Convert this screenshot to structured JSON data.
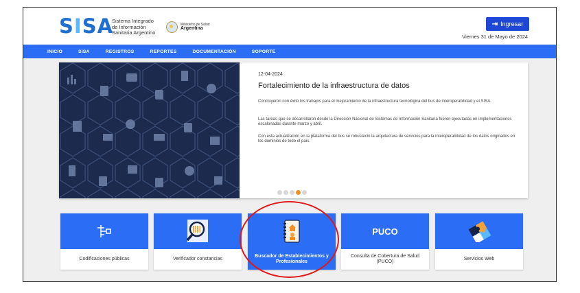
{
  "header": {
    "logo_word_prefix": "S",
    "logo_word_i": "I",
    "logo_word_suffix": "SA",
    "logo_sub": [
      "Sistema Integrado",
      "de Información",
      "Sanitaria Argentino"
    ],
    "ministry_line": "Ministerio de Salud",
    "ministry_country": "Argentina",
    "login_label": "Ingresar",
    "login_icon": "sign-in-icon",
    "date": "Viernes 31 de Mayo de 2024"
  },
  "nav": {
    "items": [
      "INICIO",
      "SISA",
      "REGISTROS",
      "REPORTES",
      "DOCUMENTACIÓN",
      "SOPORTE"
    ]
  },
  "news": {
    "date": "12-04-2024",
    "title": "Fortalecimiento de la infraestructura de datos",
    "paragraphs": [
      "Concluyeron con éxito los trabajos para el mejoramiento de la infraestructura tecnológica del bus de interoperabilidad y el SISA.",
      "Las tareas que se desarrollaron desde la Dirección Nacional de Sistemas de Información Sanitaria fueron ejecutadas en implementaciones escalonadas durante marzo y abril.",
      "Con esta actualización en la plataforma del bus se robusteció la arquitectura de servicios para la interoperabilidad de los datos originados en los dominios de todo el país."
    ],
    "carousel_active": 3,
    "carousel_count": 4
  },
  "tiles": [
    {
      "label": "Codificaciones públicas",
      "icon": "hierarchy-icon"
    },
    {
      "label": "Verificador constancias",
      "icon": "magnifier-barcode-icon"
    },
    {
      "label": "Buscador de Establecimientos y Profesionales",
      "icon": "notebook-doctor-icon",
      "selected": true
    },
    {
      "label": "Consulta de Cobertura de Salud (PUCO)",
      "icon_text": "PUCO"
    },
    {
      "label": "Servicios Web",
      "icon": "puzzle-icon"
    }
  ],
  "colors": {
    "brand_blue": "#2b6ef5",
    "login_blue": "#1f47d6",
    "hero_navy": "#1b2a4d",
    "carousel_active": "#f29023",
    "highlight_red": "#e01818"
  }
}
